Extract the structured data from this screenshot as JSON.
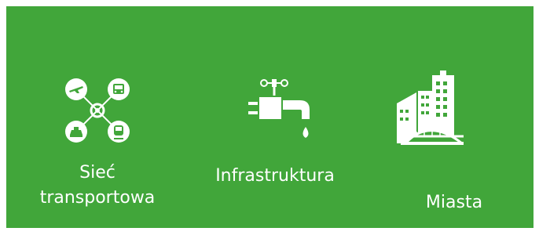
{
  "tiles": [
    {
      "icon": "transport-network-icon",
      "label_line1": "Sieć",
      "label_line2": "transportowa"
    },
    {
      "icon": "infrastructure-tap-icon",
      "label": "Infrastruktura"
    },
    {
      "icon": "city-buildings-icon",
      "label": "Miasta"
    }
  ],
  "colors": {
    "background": "#41a63a",
    "foreground": "#ffffff"
  }
}
